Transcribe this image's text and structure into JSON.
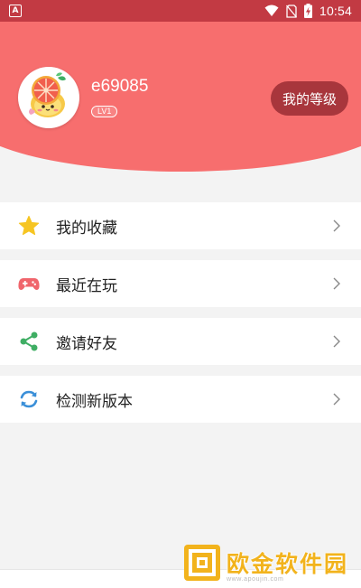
{
  "status_bar": {
    "app_icon_letter": "A",
    "time": "10:54"
  },
  "profile": {
    "username": "e69085",
    "level": "LV1",
    "level_button_label": "我的等级"
  },
  "menu": {
    "items": [
      {
        "label": "我的收藏",
        "icon": "star-icon"
      },
      {
        "label": "最近在玩",
        "icon": "gamepad-icon"
      },
      {
        "label": "邀请好友",
        "icon": "share-icon"
      },
      {
        "label": "检测新版本",
        "icon": "refresh-icon"
      }
    ]
  },
  "watermark": {
    "text": "欧金软件园",
    "url": "www.apoujin.com"
  },
  "colors": {
    "header": "#f76e6e",
    "status_bar": "#c23a43",
    "level_button": "#a8363c",
    "star": "#f6c522",
    "gamepad": "#f0656c",
    "share": "#3fae64",
    "refresh": "#3a8fd8"
  }
}
